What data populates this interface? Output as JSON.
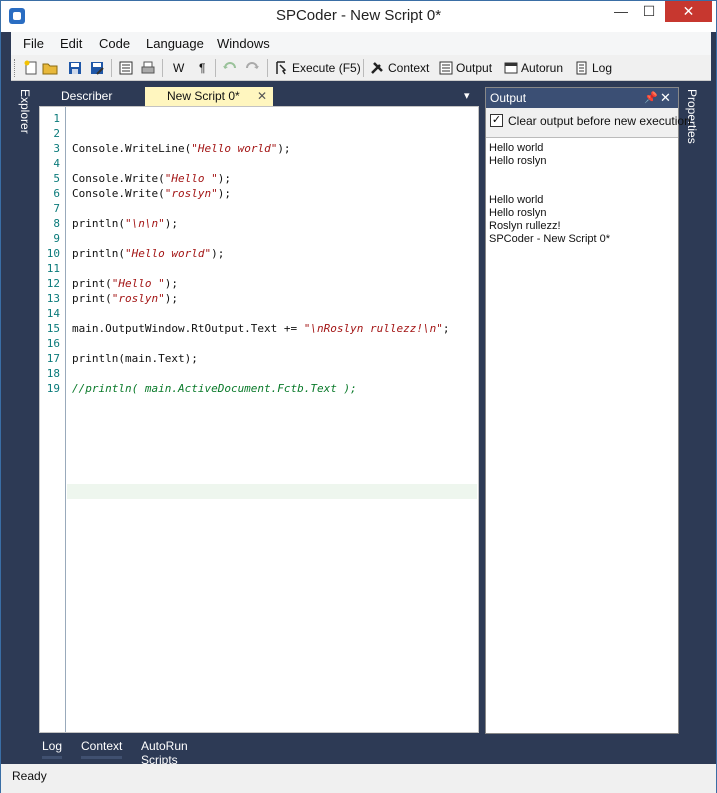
{
  "window": {
    "title": "SPCoder - New Script 0*",
    "minimize": "—",
    "maximize": "☐",
    "close": "✕"
  },
  "menu": [
    "File",
    "Edit",
    "Code",
    "Language",
    "Windows"
  ],
  "toolbar": {
    "w_label": "W",
    "pilcrow": "¶",
    "execute": "Execute (F5)",
    "context": "Context",
    "output": "Output",
    "autorun": "Autorun",
    "log": "Log"
  },
  "side": {
    "left": "Explorer",
    "right": "Properties"
  },
  "doc_tabs": [
    {
      "label": "Describer"
    },
    {
      "label": "New Script 0*",
      "close": "✕"
    }
  ],
  "tabs_dropdown": "▾",
  "editor": {
    "lines": [
      {
        "n": "1",
        "text": ""
      },
      {
        "n": "2",
        "text": ""
      },
      {
        "n": "3",
        "text": "Console.WriteLine(\"Hello world\");"
      },
      {
        "n": "4",
        "text": ""
      },
      {
        "n": "5",
        "text": "Console.Write(\"Hello \");"
      },
      {
        "n": "6",
        "text": "Console.Write(\"roslyn\");"
      },
      {
        "n": "7",
        "text": ""
      },
      {
        "n": "8",
        "text": "println(\"\\n\\n\");"
      },
      {
        "n": "9",
        "text": ""
      },
      {
        "n": "10",
        "text": "println(\"Hello world\");"
      },
      {
        "n": "11",
        "text": ""
      },
      {
        "n": "12",
        "text": "print(\"Hello \");"
      },
      {
        "n": "13",
        "text": "print(\"roslyn\");"
      },
      {
        "n": "14",
        "text": ""
      },
      {
        "n": "15",
        "text": "main.OutputWindow.RtOutput.Text += \"\\nRoslyn rullezz!\\n\";"
      },
      {
        "n": "16",
        "text": ""
      },
      {
        "n": "17",
        "text": "println(main.Text);"
      },
      {
        "n": "18",
        "text": ""
      },
      {
        "n": "19",
        "text": "//println( main.ActiveDocument.Fctb.Text );"
      }
    ]
  },
  "output": {
    "title": "Output",
    "pin": "📌",
    "close": "✕",
    "clear_label": "Clear output before new execution",
    "clear_checked": "✓",
    "lines": [
      "Hello world",
      "Hello roslyn",
      "",
      "",
      "Hello world",
      "Hello roslyn",
      "Roslyn rullezz!",
      "SPCoder - New Script 0*"
    ]
  },
  "bottom_tabs": [
    "Log",
    "Context",
    "AutoRun Scripts"
  ],
  "status": "Ready"
}
